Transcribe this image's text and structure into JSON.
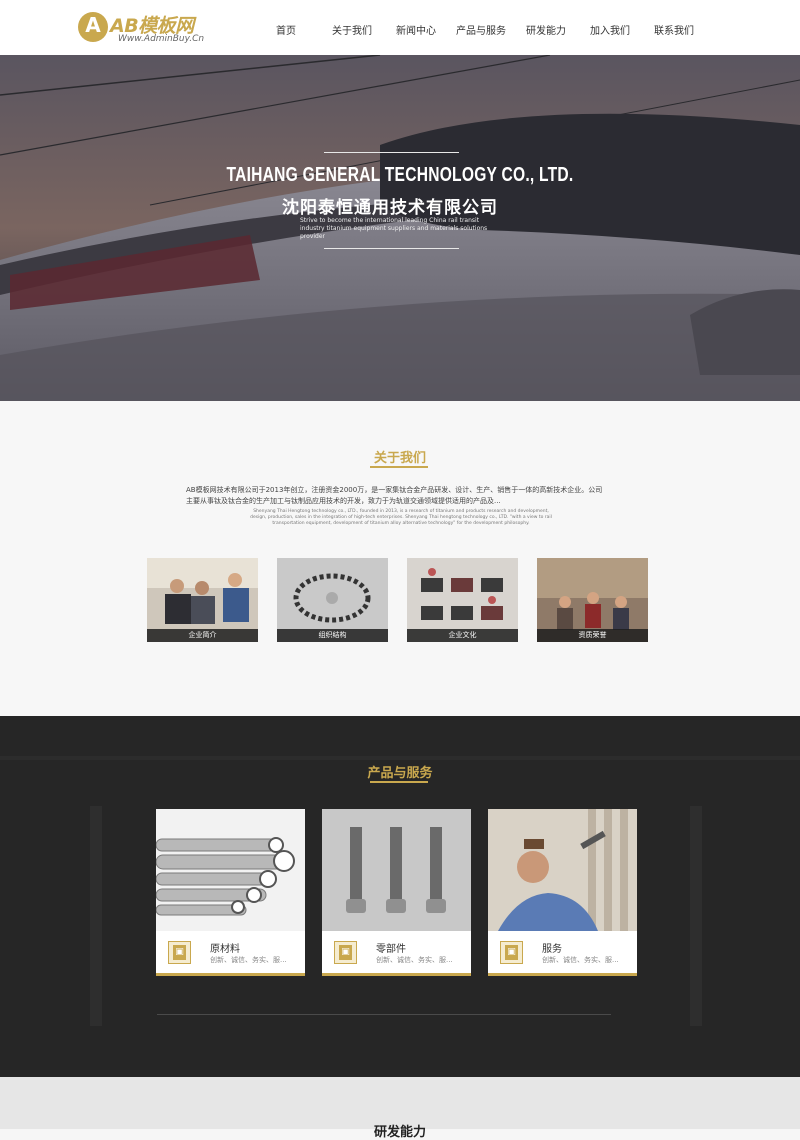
{
  "logo": {
    "mark": "A",
    "name": "AB模板网",
    "subtitle": "Www.AdminBuy.Cn"
  },
  "nav": {
    "items": [
      "首页",
      "关于我们",
      "新闻中心",
      "产品与服务",
      "研发能力",
      "加入我们",
      "联系我们"
    ]
  },
  "hero": {
    "title_en": "TAIHANG GENERAL TECHNOLOGY CO., LTD.",
    "title_cn": "沈阳泰恒通用技术有限公司",
    "desc": "Strive to become the international leading China rail transit industry titanium equipment suppliers and materials solutions provider"
  },
  "about": {
    "title": "关于我们",
    "text_cn": "AB模板网技术有限公司于2013年创立，注册资金2000万，是一家集钛合金产品研发、设计、生产、销售于一体的高新技术企业。公司主要从事钛及钛合金的生产加工与钛制品应用技术的开发，致力于为轨道交通领域提供适用的产品及...",
    "text_en": "Shenyang Thai Hengtong technology co., LTD., founded in 2013, is a research of titanium and products research and development, design, production, sales in the integration of high-tech enterprises. Shenyang Thai hengtong technology co., LTD. \"with a view to rail transportation equipment, development of titanium alloy alternative technology\" for the development philosophy.",
    "cards": [
      {
        "label": "企业简介"
      },
      {
        "label": "组织结构"
      },
      {
        "label": "企业文化"
      },
      {
        "label": "资质荣誉"
      }
    ]
  },
  "products": {
    "title": "产品与服务",
    "items": [
      {
        "name": "原材料",
        "desc": "创新、诚信、务实、服..."
      },
      {
        "name": "零部件",
        "desc": "创新、诚信、务实、服..."
      },
      {
        "name": "服务",
        "desc": "创新、诚信、务实、服..."
      }
    ]
  },
  "research": {
    "title": "研发能力"
  },
  "colors": {
    "gold": "#c9a84e",
    "dark": "#262626"
  }
}
